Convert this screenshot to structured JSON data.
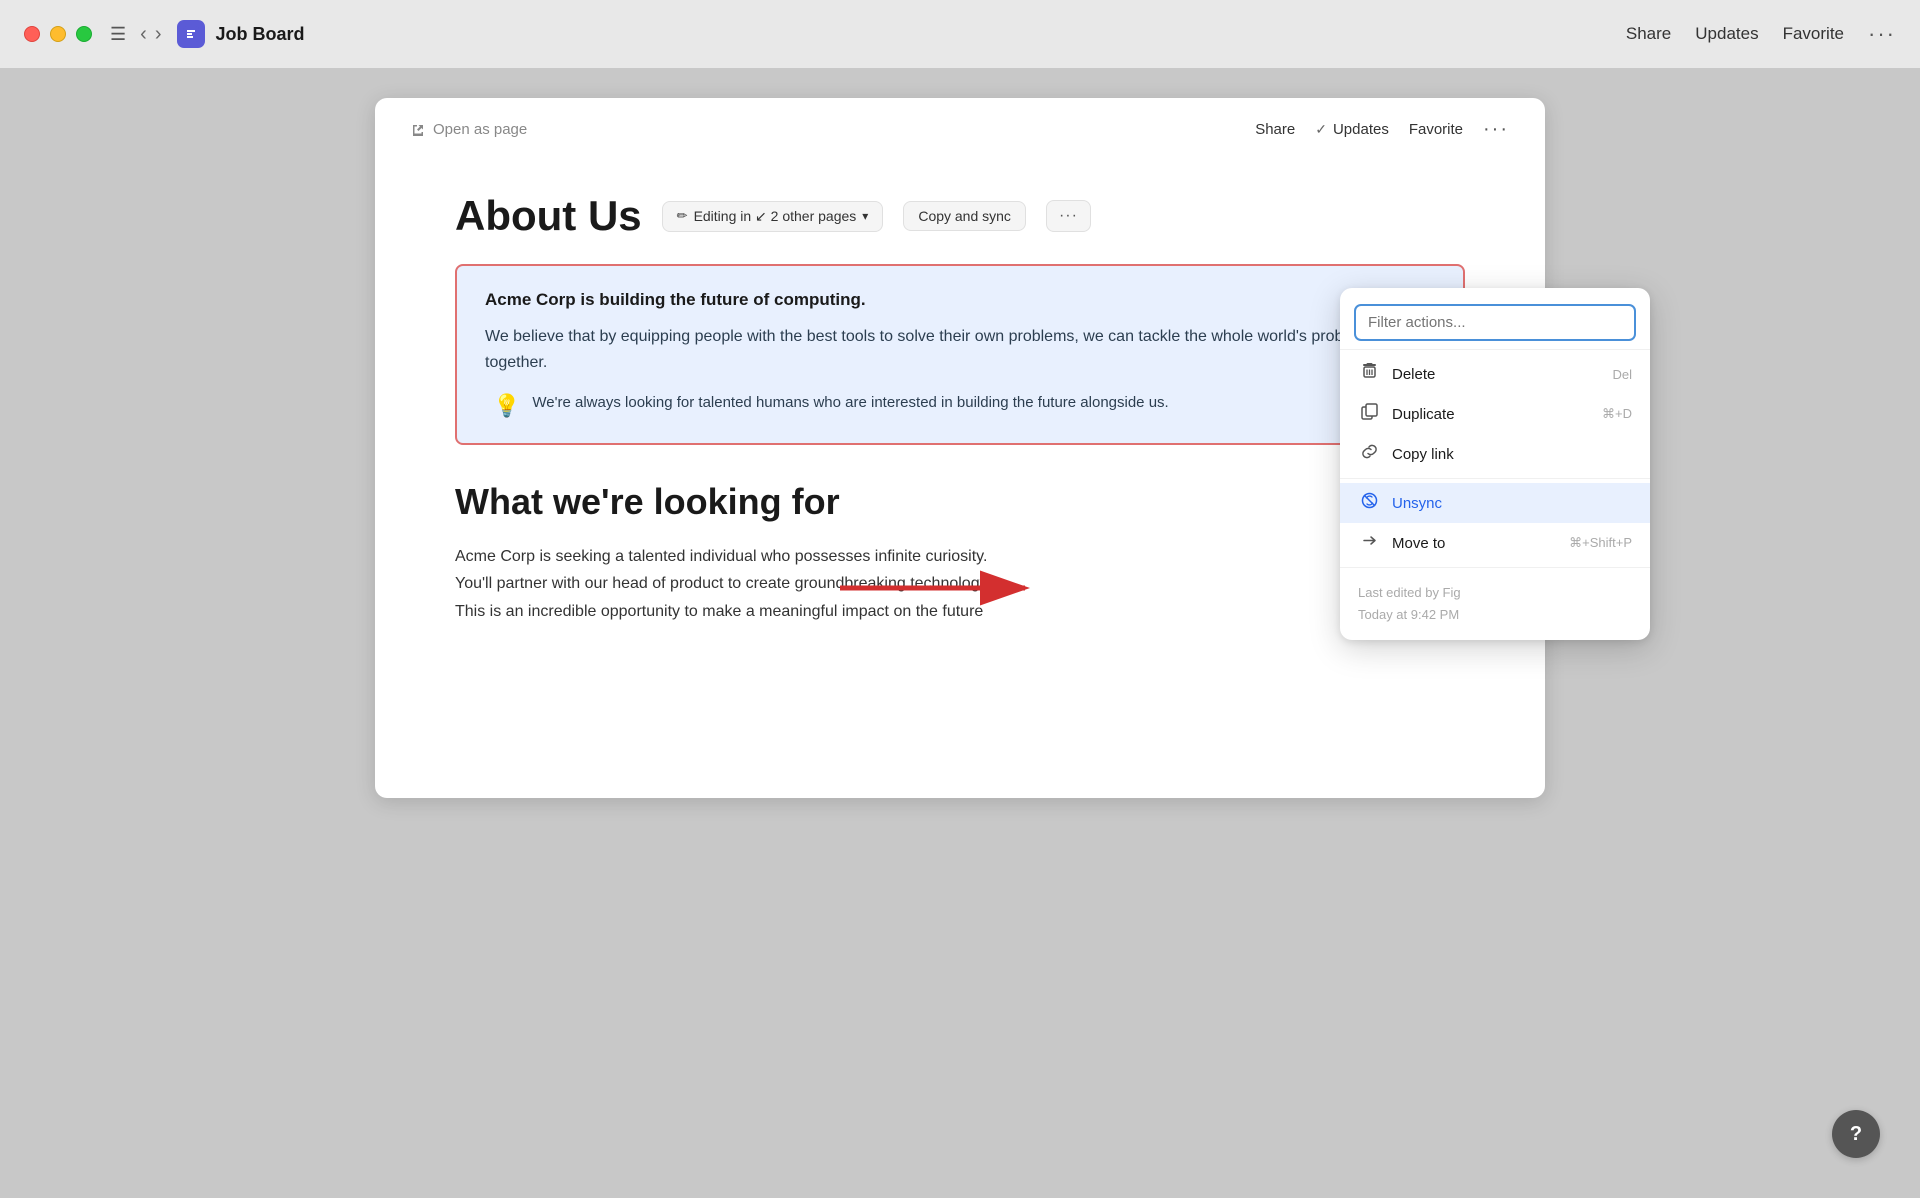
{
  "titlebar": {
    "page_title": "Job Board",
    "share_label": "Share",
    "updates_label": "Updates",
    "favorite_label": "Favorite",
    "more_label": "···"
  },
  "doc_toolbar": {
    "open_as_page": "Open as page",
    "share_label": "Share",
    "updates_label": "Updates",
    "favorite_label": "Favorite",
    "more_label": "···"
  },
  "doc_content": {
    "about_us_title": "About Us",
    "editing_badge": "Editing in ↙ 2 other pages",
    "copy_sync_label": "Copy and sync",
    "synced_title": "Acme Corp is building the future of computing.",
    "synced_body": "We believe that by equipping people with the best tools to solve their own problems, we can tackle the whole world's problems better, together.",
    "synced_note": "We're always looking for talented humans who are interested in building the future alongside us.",
    "what_looking_title": "What we're looking for",
    "what_looking_body": "Acme Corp is seeking a talented individual who possesses infinite curiosity.\nYou'll partner with our head of product to create groundbreaking technology.\nThis is an incredible opportunity to make a meaningful impact on the future"
  },
  "context_menu": {
    "filter_placeholder": "Filter actions...",
    "delete_label": "Delete",
    "delete_shortcut": "Del",
    "duplicate_label": "Duplicate",
    "duplicate_shortcut": "⌘+D",
    "copy_link_label": "Copy link",
    "unsync_label": "Unsync",
    "move_to_label": "Move to",
    "move_to_shortcut": "⌘+Shift+P",
    "last_edited_by": "Last edited by Fig",
    "last_edited_time": "Today at 9:42 PM"
  },
  "help": {
    "label": "?"
  }
}
